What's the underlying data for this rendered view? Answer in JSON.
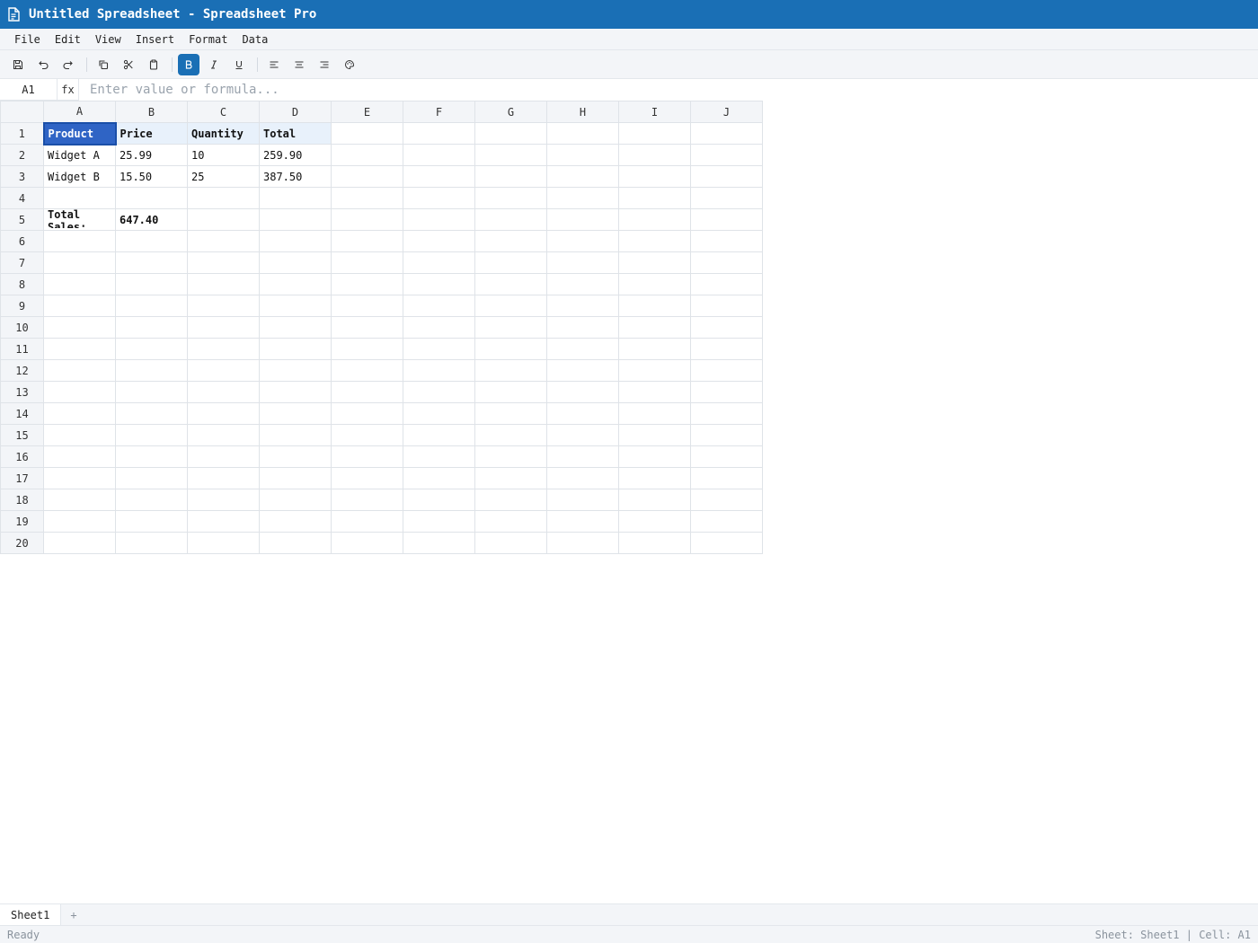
{
  "window": {
    "title": "Untitled Spreadsheet - Spreadsheet Pro",
    "icon": "document-icon"
  },
  "menu": [
    "File",
    "Edit",
    "View",
    "Insert",
    "Format",
    "Data"
  ],
  "toolbar": {
    "buttons": [
      {
        "name": "save-icon",
        "icon": "save"
      },
      {
        "name": "undo-icon",
        "icon": "undo"
      },
      {
        "name": "redo-icon",
        "icon": "redo"
      },
      {
        "name": "copy-icon",
        "icon": "copy"
      },
      {
        "name": "cut-icon",
        "icon": "scissors"
      },
      {
        "name": "paste-icon",
        "icon": "clipboard"
      },
      {
        "name": "bold-icon",
        "icon": "bold",
        "active": true
      },
      {
        "name": "italic-icon",
        "icon": "italic"
      },
      {
        "name": "underline-icon",
        "icon": "underline"
      },
      {
        "name": "align-left-icon",
        "icon": "align-left"
      },
      {
        "name": "align-center-icon",
        "icon": "align-center"
      },
      {
        "name": "align-right-icon",
        "icon": "align-right"
      },
      {
        "name": "palette-icon",
        "icon": "palette"
      }
    ],
    "accent_color": "#1a6fb5"
  },
  "formula_bar": {
    "cell_ref": "A1",
    "fx_label": "fx",
    "value": "",
    "placeholder": "Enter value or formula..."
  },
  "grid": {
    "columns": [
      "A",
      "B",
      "C",
      "D",
      "E",
      "F",
      "G",
      "H",
      "I",
      "J"
    ],
    "row_count": 20,
    "selected_cell": "A1",
    "cells": {
      "A1": "Product",
      "B1": "Price",
      "C1": "Quantity",
      "D1": "Total",
      "A2": "Widget A",
      "B2": "25.99",
      "C2": "10",
      "D2": "259.90",
      "A3": "Widget B",
      "B3": "15.50",
      "C3": "25",
      "D3": "387.50",
      "A5": "Total Sales:",
      "B5": "647.40"
    },
    "bold_cells": [
      "A1",
      "B1",
      "C1",
      "D1",
      "A5",
      "B5"
    ],
    "highlighted_cells": [
      "B1",
      "C1",
      "D1"
    ],
    "wrapped_cells": [
      "A5"
    ]
  },
  "sheet_tabs": {
    "tabs": [
      "Sheet1"
    ],
    "add_label": "+"
  },
  "status": {
    "left": "Ready",
    "right": "Sheet: Sheet1 | Cell: A1"
  }
}
